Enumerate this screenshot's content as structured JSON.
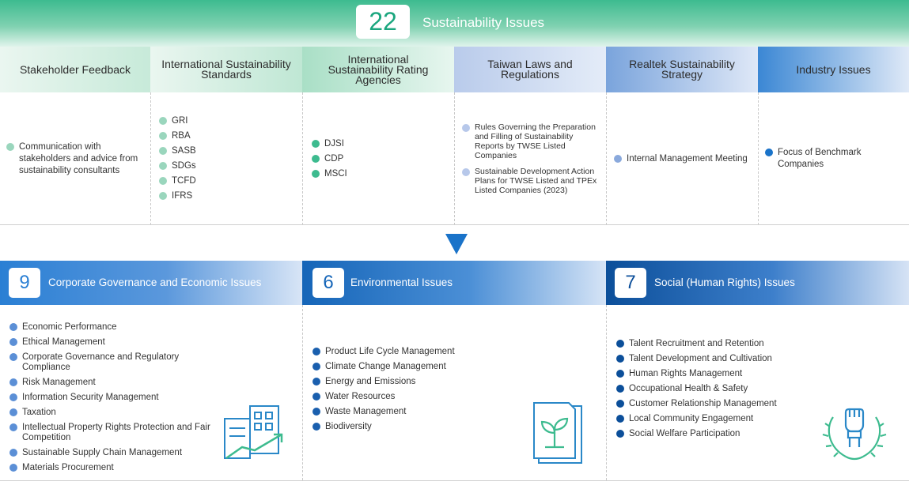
{
  "banner": {
    "count": "22",
    "title": "Sustainability Issues"
  },
  "sources": [
    {
      "title": "Stakeholder Feedback",
      "dot_color": "#9ad6bd",
      "items": [
        "Communication with stakeholders and advice from sustainability consultants"
      ]
    },
    {
      "title": "International Sustainability Standards",
      "dot_color": "#9ad6bd",
      "items": [
        "GRI",
        "RBA",
        "SASB",
        "SDGs",
        "TCFD",
        "IFRS"
      ]
    },
    {
      "title": "International Sustainability Rating Agencies",
      "dot_color": "#3dbb8f",
      "items": [
        "DJSI",
        "CDP",
        "MSCI"
      ]
    },
    {
      "title": "Taiwan Laws and Regulations",
      "dot_color": "#b7c8ea",
      "items": [
        "Rules Governing the Preparation and Filling of Sustainability Reports by TWSE Listed Companies",
        "Sustainable Development Action Plans for TWSE Listed and TPEx Listed Companies (2023)"
      ]
    },
    {
      "title": "Realtek Sustainability Strategy",
      "dot_color": "#8aa9dc",
      "items": [
        "Internal Management Meeting"
      ]
    },
    {
      "title": "Industry Issues",
      "dot_color": "#1a73c9",
      "items": [
        "Focus of Benchmark Companies"
      ]
    }
  ],
  "categories": [
    {
      "count": "9",
      "title": "Corporate Governance and Economic Issues",
      "color": "#2a7fd4",
      "dot_color": "#5b8fd6",
      "items": [
        "Economic Performance",
        "Ethical Management",
        "Corporate Governance and Regulatory Compliance",
        "Risk Management",
        "Information Security Management",
        "Taxation",
        "Intellectual Property Rights Protection and Fair Competition",
        "Sustainable Supply Chain Management",
        "Materials Procurement"
      ],
      "icon": "buildings-growth-icon"
    },
    {
      "count": "6",
      "title": "Environmental Issues",
      "color": "#1565b8",
      "dot_color": "#1a5fae",
      "items": [
        "Product Life Cycle Management",
        "Climate Change Management",
        "Energy and Emissions",
        "Water Resources",
        "Waste Management",
        "Biodiversity"
      ],
      "icon": "document-sprout-icon"
    },
    {
      "count": "7",
      "title": "Social (Human Rights) Issues",
      "color": "#0c4f9a",
      "dot_color": "#0c4f9a",
      "items": [
        "Talent Recruitment and Retention",
        "Talent Development and Cultivation",
        "Human Rights Management",
        "Occupational Health & Safety",
        "Customer Relationship Management",
        "Local Community Engagement",
        "Social Welfare Participation"
      ],
      "icon": "fist-laurel-icon"
    }
  ]
}
